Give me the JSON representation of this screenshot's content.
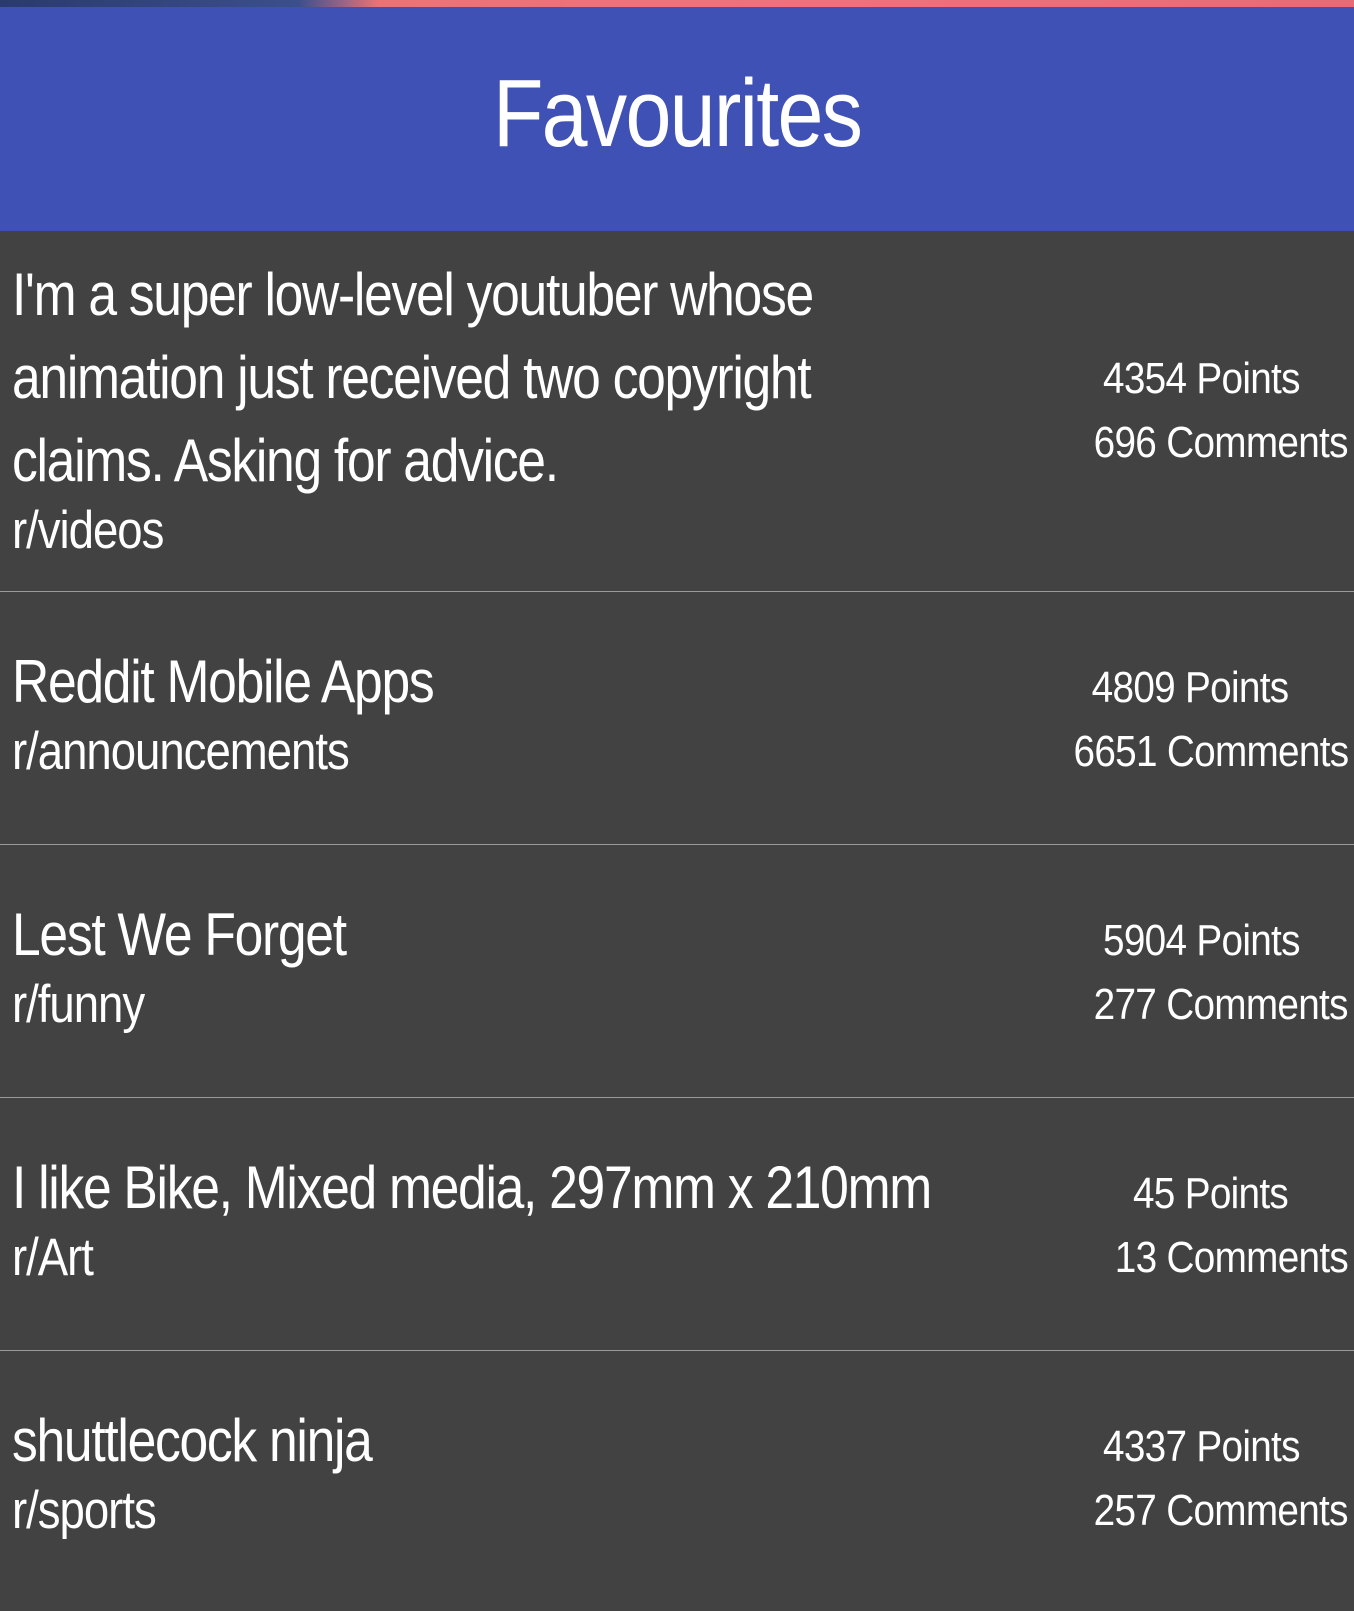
{
  "header": {
    "title": "Favourites"
  },
  "posts": [
    {
      "title": "I'm a super low-level youtuber whose animation just received two copyright claims. Asking for advice.",
      "subreddit": "r/videos",
      "points": "4354 Points",
      "comments": "696 Comments"
    },
    {
      "title": "Reddit Mobile Apps",
      "subreddit": "r/announcements",
      "points": "4809 Points",
      "comments": "6651 Comments"
    },
    {
      "title": "Lest We Forget",
      "subreddit": "r/funny",
      "points": "5904 Points",
      "comments": "277 Comments"
    },
    {
      "title": "I like Bike, Mixed media, 297mm x 210mm",
      "subreddit": "r/Art",
      "points": "45 Points",
      "comments": "13 Comments"
    },
    {
      "title": "shuttlecock ninja",
      "subreddit": "r/sports",
      "points": "4337 Points",
      "comments": "257 Comments"
    }
  ]
}
